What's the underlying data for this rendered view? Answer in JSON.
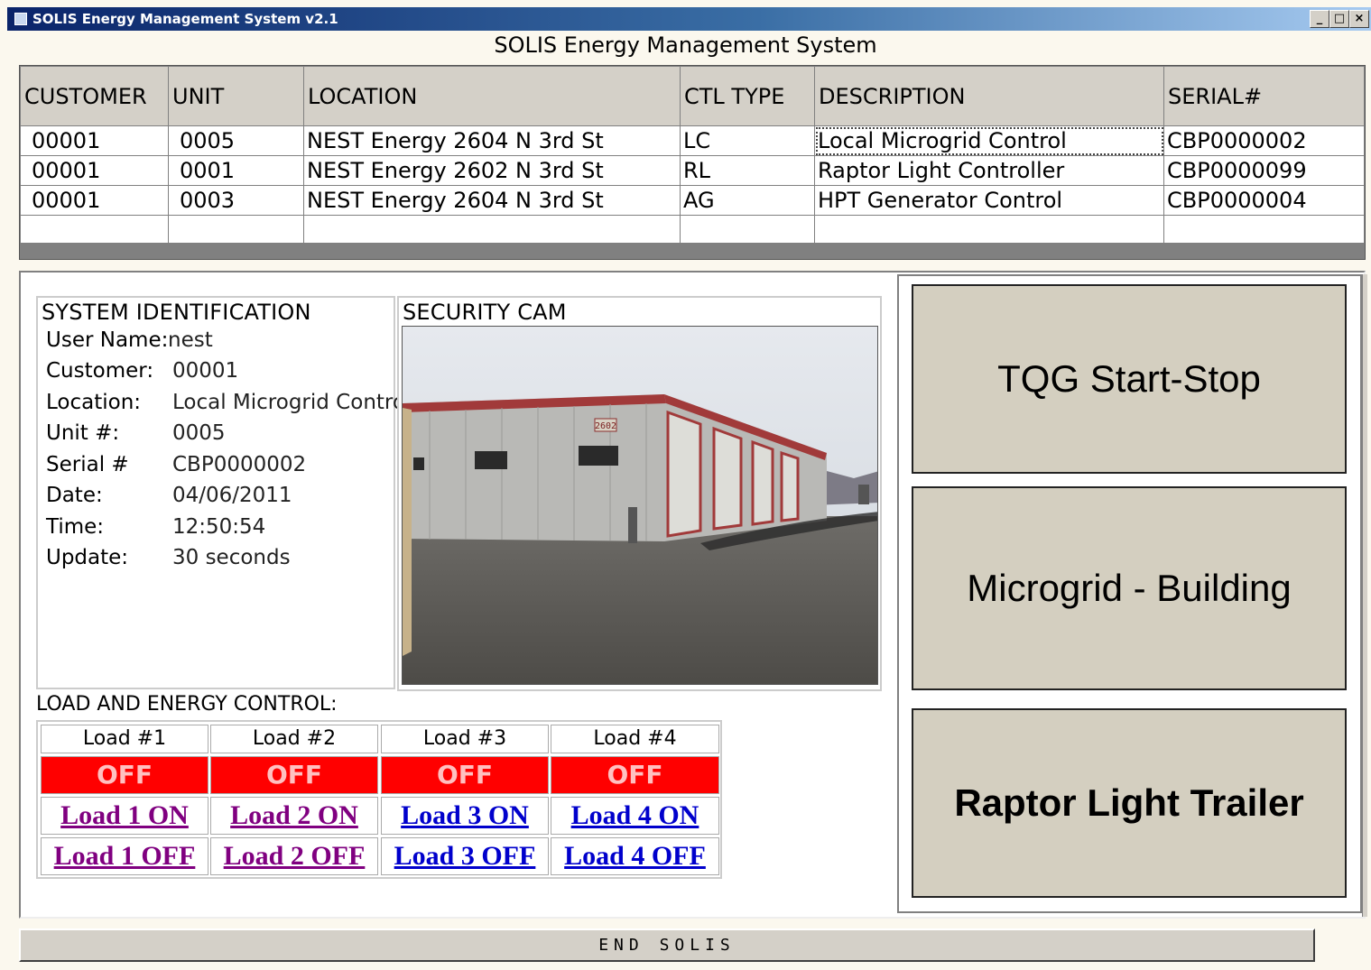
{
  "window": {
    "title": "SOLIS Energy Management System v2.1",
    "controls": [
      "_",
      "□",
      "×"
    ]
  },
  "main_title": "SOLIS Energy Management System",
  "grid": {
    "columns": [
      "CUSTOMER",
      "UNIT",
      "LOCATION",
      "CTL TYPE",
      "DESCRIPTION",
      "SERIAL#"
    ],
    "rows": [
      [
        "00001",
        "0005",
        "NEST Energy 2604 N 3rd St",
        "LC",
        "Local Microgrid Control",
        "CBP0000002"
      ],
      [
        "00001",
        "0001",
        "NEST Energy 2602 N 3rd St",
        "RL",
        "Raptor Light Controller",
        "CBP0000099"
      ],
      [
        "00001",
        "0003",
        "NEST Energy 2604 N 3rd St",
        "AG",
        "HPT Generator Control",
        "CBP0000004"
      ]
    ]
  },
  "system_identification": {
    "heading": "SYSTEM IDENTIFICATION",
    "fields": [
      {
        "label": "User Name:",
        "value": "nest"
      },
      {
        "label": "Customer:",
        "value": "00001"
      },
      {
        "label": "Location:",
        "value": "Local Microgrid Control"
      },
      {
        "label": "Unit #:",
        "value": "0005"
      },
      {
        "label": "Serial #",
        "value": "CBP0000002"
      },
      {
        "label": "Date:",
        "value": "04/06/2011"
      },
      {
        "label": "Time:",
        "value": "12:50:54"
      },
      {
        "label": "Update:",
        "value": "30 seconds"
      }
    ]
  },
  "security_cam": {
    "heading": "SECURITY CAM",
    "sign": "2602"
  },
  "load_control": {
    "heading": "LOAD AND ENERGY CONTROL:",
    "loads": [
      {
        "name": "Load #1",
        "status": "OFF",
        "on_label": "Load 1 ON",
        "off_label": "Load 1 OFF"
      },
      {
        "name": "Load #2",
        "status": "OFF",
        "on_label": "Load 2 ON",
        "off_label": "Load 2 OFF"
      },
      {
        "name": "Load #3",
        "status": "OFF",
        "on_label": "Load 3 ON",
        "off_label": "Load 3 OFF"
      },
      {
        "name": "Load #4",
        "status": "OFF",
        "on_label": "Load 4 ON",
        "off_label": "Load 4 OFF"
      }
    ]
  },
  "side_buttons": [
    "TQG Start-Stop",
    "Microgrid - Building",
    "Raptor Light Trailer"
  ],
  "end_button": "END SOLIS",
  "colors": {
    "title_bar": "#0a246a",
    "off_status": "#ff0000",
    "visited_link": "#800080",
    "link": "#0000cc",
    "side_button": "#d4cfc0"
  }
}
